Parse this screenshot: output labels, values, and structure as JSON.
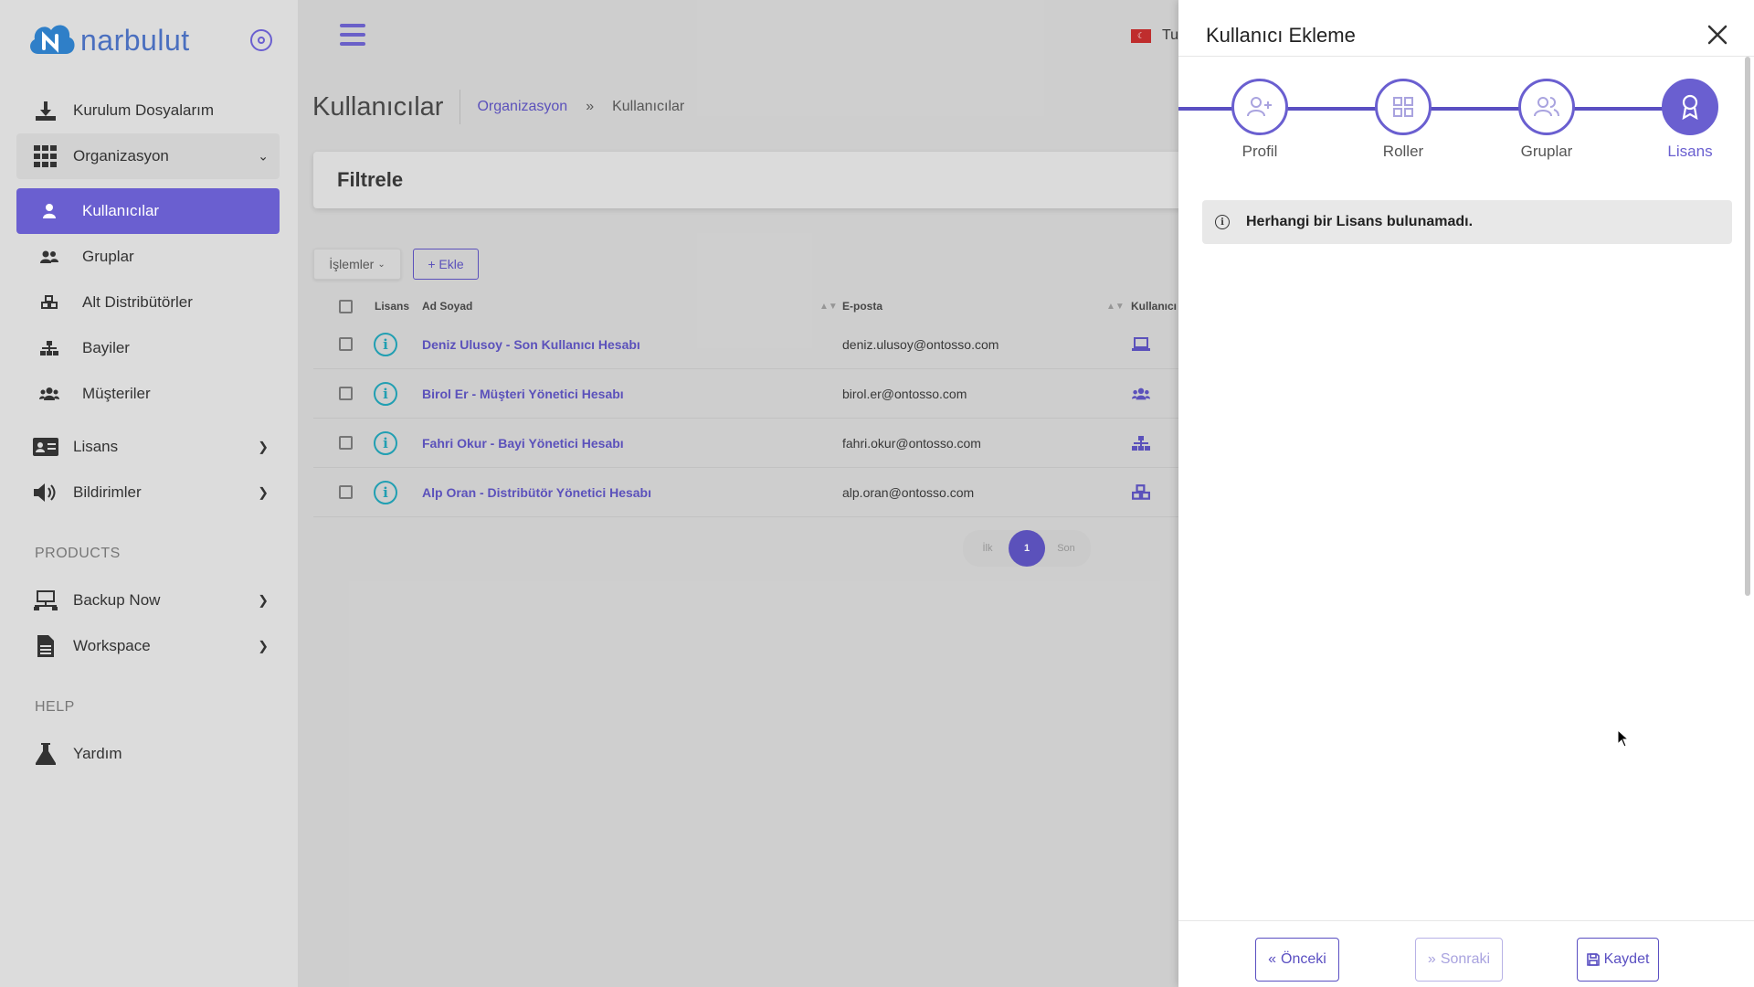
{
  "brand": {
    "name": "narbulut",
    "accent": "#6a5fd0",
    "link": "#5a4fc2",
    "info": "#1ba3b8"
  },
  "sidebar": {
    "items": [
      {
        "label": "Kurulum Dosyalarım",
        "icon": "download-icon"
      },
      {
        "label": "Organizasyon",
        "icon": "grid-icon"
      },
      {
        "label": "Kullanıcılar",
        "icon": "user-icon"
      },
      {
        "label": "Gruplar",
        "icon": "users-icon"
      },
      {
        "label": "Alt Distribütörler",
        "icon": "cubes-icon"
      },
      {
        "label": "Bayiler",
        "icon": "sitemap-icon"
      },
      {
        "label": "Müşteriler",
        "icon": "people-group-icon"
      },
      {
        "label": "Lisans",
        "icon": "id-card-icon"
      },
      {
        "label": "Bildirimler",
        "icon": "speaker-icon"
      }
    ],
    "products_label": "PRODUCTS",
    "products": [
      {
        "label": "Backup Now",
        "icon": "network-icon"
      },
      {
        "label": "Workspace",
        "icon": "document-icon"
      }
    ],
    "help_label": "HELP",
    "help": [
      {
        "label": "Yardım",
        "icon": "flask-icon"
      }
    ]
  },
  "topbar": {
    "language": "Tu"
  },
  "page": {
    "title": "Kullanıcılar",
    "breadcrumb": {
      "parent": "Organizasyon",
      "separator": "»",
      "current": "Kullanıcılar"
    },
    "filter_title": "Filtrele",
    "actions_label": "İşlemler",
    "add_label": "+ Ekle"
  },
  "table": {
    "columns": {
      "license": "Lisans",
      "name": "Ad Soyad",
      "email": "E-posta",
      "user": "Kullanıcı"
    },
    "rows": [
      {
        "name": "Deniz Ulusoy - Son Kullanıcı Hesabı",
        "email": "deniz.ulusoy@ontosso.com",
        "type_icon": "laptop-icon"
      },
      {
        "name": "Birol Er - Müşteri Yönetici Hesabı",
        "email": "birol.er@ontosso.com",
        "type_icon": "people-group-icon"
      },
      {
        "name": "Fahri Okur - Bayi Yönetici Hesabı",
        "email": "fahri.okur@ontosso.com",
        "type_icon": "sitemap-icon"
      },
      {
        "name": "Alp Oran - Distribütör Yönetici Hesabı",
        "email": "alp.oran@ontosso.com",
        "type_icon": "cubes-icon"
      }
    ]
  },
  "pagination": {
    "first": "İlk",
    "current": "1",
    "last": "Son"
  },
  "panel": {
    "title": "Kullanıcı Ekleme",
    "steps": [
      {
        "label": "Profil",
        "icon": "user-plus-icon"
      },
      {
        "label": "Roller",
        "icon": "grid-icon"
      },
      {
        "label": "Gruplar",
        "icon": "users-icon"
      },
      {
        "label": "Lisans",
        "icon": "award-icon"
      }
    ],
    "active_step": "Lisans",
    "alert": "Herhangi bir Lisans bulunamadı.",
    "footer": {
      "prev": "Önceki",
      "next": "Sonraki",
      "save": "Kaydet"
    }
  }
}
